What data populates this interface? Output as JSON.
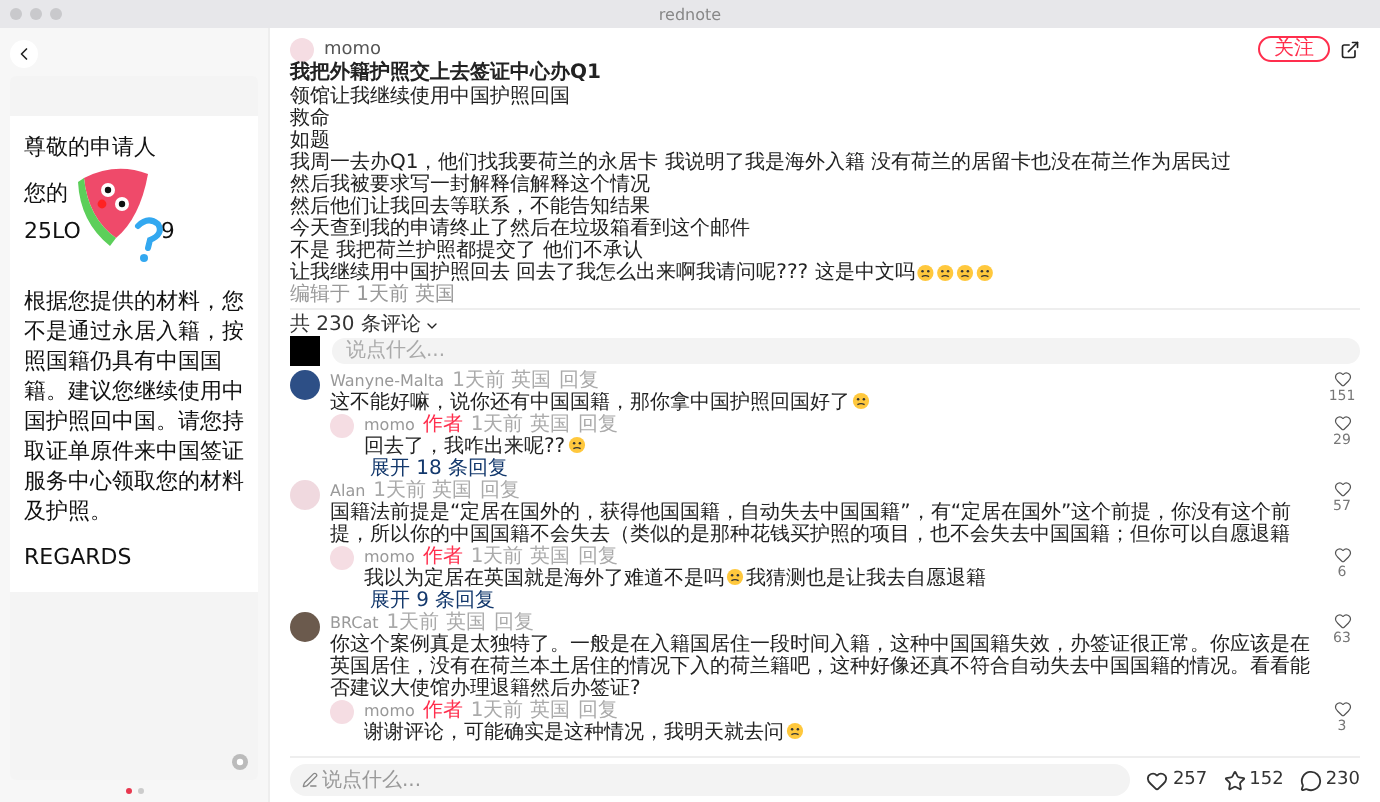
{
  "window": {
    "title": "rednote"
  },
  "letter": {
    "greeting": "尊敬的申请人",
    "line_2_visible": "您的",
    "reference_start": "25LO",
    "reference_end": "9",
    "body": "根据您提供的材料，您不是通过永居入籍，按照国籍仍具有中国国籍。建议您继续使用中国护照回中国。请您持取证单原件来中国签证服务中心领取您的材料及护照。",
    "closing": "REGARDS"
  },
  "carousel": {
    "dots": [
      {
        "selected": true
      },
      {
        "selected": false
      }
    ]
  },
  "post": {
    "author": "momo",
    "follow_button": "关注",
    "title": "我把外籍护照交上去签证中心办Q1",
    "body_lines": [
      {
        "text": "领馆让我继续使用中国护照回国"
      },
      {
        "text": "救命"
      },
      {
        "text": "如题"
      },
      {
        "text": "我周一去办Q1，他们找我要荷兰的永居卡 我说明了我是海外入籍 没有荷兰的居留卡也没在荷兰作为居民过"
      },
      {
        "text": "然后我被要求写一封解释信解释这个情况"
      },
      {
        "text": "然后他们让我回去等联系，不能告知结果"
      },
      {
        "text": "今天查到我的申请终止了然后在垃圾箱看到这个邮件"
      },
      {
        "text": "不是 我把荷兰护照都提交了 他们不承认"
      },
      {
        "text": "让我继续用中国护照回去 回去了我怎么出来啊我请问呢??? 这是中文吗",
        "emoji": true
      }
    ],
    "meta": "编辑于 1天前 英国"
  },
  "comments_header": "共 230 条评论",
  "comment_input": {
    "placeholder": "说点什么..."
  },
  "comments": [
    {
      "author": "Wanyne-Malta",
      "text": "这不能好嘛，说你还有中国国籍，那你拿中国护照回国好了",
      "emoji": true,
      "time": "1天前",
      "location": "英国",
      "reply": "回复",
      "likes": "151",
      "replies": [
        {
          "author": "momo",
          "badge": "作者",
          "text": "回去了，我咋出来呢??",
          "emoji": true,
          "time": "1天前",
          "location": "英国",
          "reply": "回复",
          "likes": "29"
        }
      ],
      "expand": "展开 18 条回复"
    },
    {
      "author": "Alan",
      "text": "国籍法前提是“定居在国外的，获得他国国籍，自动失去中国国籍”，有“定居在国外”这个前提，你没有这个前提，所以你的中国国籍不会失去（类似的是那种花钱买护照的项目，也不会失去中国国籍；但你可以自愿退籍",
      "time": "1天前",
      "location": "英国",
      "reply": "回复",
      "likes": "57",
      "replies": [
        {
          "author": "momo",
          "badge": "作者",
          "text": "我以为定居在英国就是海外了难道不是吗",
          "emoji": true,
          "text_after": "我猜测也是让我去自愿退籍",
          "time": "1天前",
          "location": "英国",
          "reply": "回复",
          "likes": "6"
        }
      ],
      "expand": "展开 9 条回复"
    },
    {
      "author": "BRCat",
      "text": "你这个案例真是太独特了。一般是在入籍国居住一段时间入籍，这种中国国籍失效，办签证很正常。你应该是在英国居住，没有在荷兰本土居住的情况下入的荷兰籍吧，这种好像还真不符合自动失去中国国籍的情况。看看能否建议大使馆办理退籍然后办签证?",
      "time": "1天前",
      "location": "英国",
      "reply": "回复",
      "likes": "63",
      "replies": [
        {
          "author": "momo",
          "badge": "作者",
          "text": "谢谢评论，可能确实是这种情况，我明天就去问",
          "emoji": true,
          "time": "1天前",
          "location": "英国",
          "reply": "回复",
          "likes": "3"
        }
      ]
    }
  ],
  "bottom_bar": {
    "placeholder": "说点什么...",
    "likes": "257",
    "collects": "152",
    "comments": "230"
  }
}
